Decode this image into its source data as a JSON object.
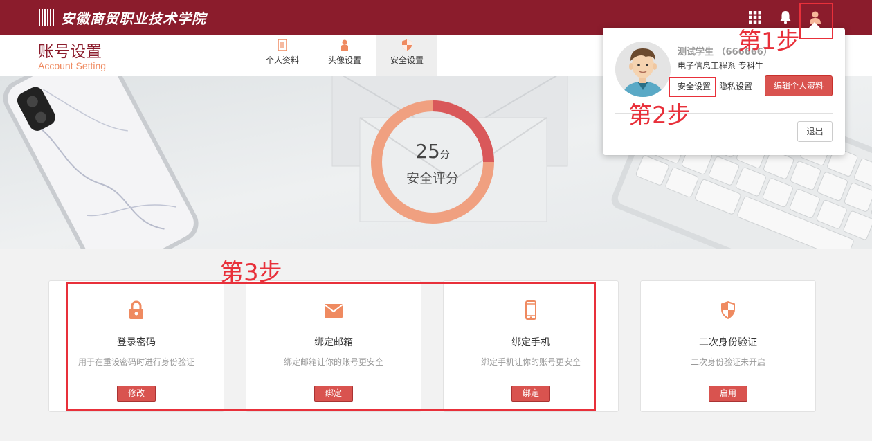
{
  "header": {
    "school_name": "安徽商贸职业技术学院",
    "icons": [
      "apps-grid-icon",
      "bell-icon",
      "user-icon"
    ]
  },
  "subheader": {
    "title": "账号设置",
    "subtitle": "Account Setting",
    "tabs": [
      {
        "label": "个人资料",
        "icon": "document-icon"
      },
      {
        "label": "头像设置",
        "icon": "person-icon"
      },
      {
        "label": "安全设置",
        "icon": "shield-icon",
        "active": true
      }
    ]
  },
  "score": {
    "value": "25",
    "unit": "分",
    "label": "安全评分",
    "fraction": 0.25
  },
  "popover": {
    "user_name": "测试学生 （666666）",
    "department": "电子信息工程系   专科生",
    "security_link": "安全设置",
    "privacy_link": "隐私设置",
    "edit_button": "编辑个人资料",
    "logout_button": "退出"
  },
  "cards": [
    {
      "icon": "lock-icon",
      "title": "登录密码",
      "desc": "用于在重设密码时进行身份验证",
      "button": "修改"
    },
    {
      "icon": "mail-icon",
      "title": "绑定邮箱",
      "desc": "绑定邮箱让你的账号更安全",
      "button": "绑定"
    },
    {
      "icon": "phone-icon",
      "title": "绑定手机",
      "desc": "绑定手机让你的账号更安全",
      "button": "绑定"
    },
    {
      "icon": "shield-icon",
      "title": "二次身份验证",
      "desc": "二次身份验证未开启",
      "button": "启用"
    }
  ],
  "annotations": {
    "step1": "第1步",
    "step2": "第2步",
    "step3": "第3步"
  },
  "colors": {
    "brand": "#8b1c2c",
    "accent": "#ef8a60",
    "button_red": "#d9534f",
    "annotation_red": "#e8303a",
    "ring_light": "#f0a080",
    "ring_dark": "#d9585a"
  }
}
